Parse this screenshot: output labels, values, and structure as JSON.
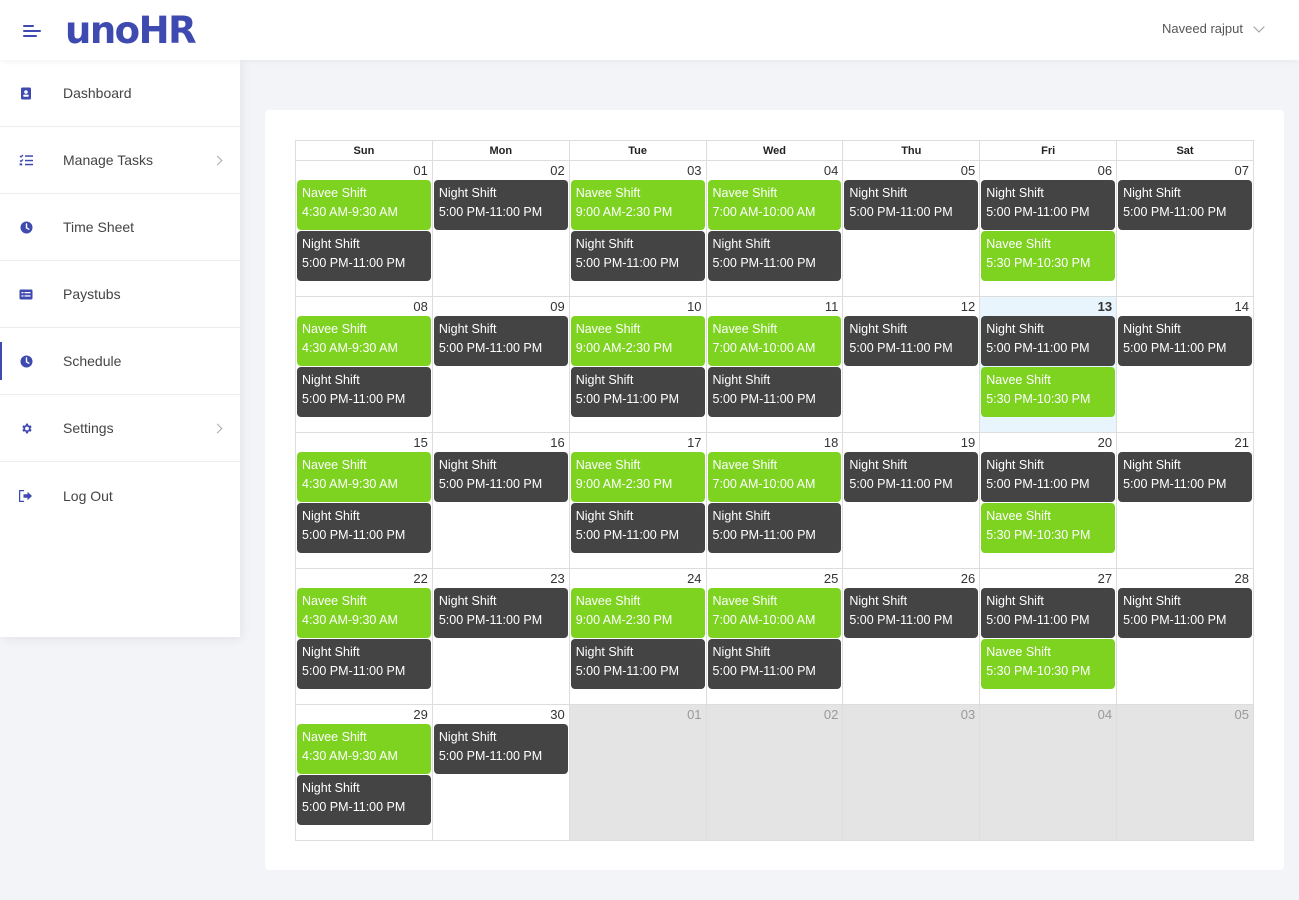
{
  "app": {
    "logo": "unoHR"
  },
  "header": {
    "user_name": "Naveed rajput"
  },
  "sidebar": {
    "items": [
      {
        "label": "Dashboard",
        "icon": "dashboard-icon",
        "has_arrow": false,
        "active": false
      },
      {
        "label": "Manage Tasks",
        "icon": "tasks-icon",
        "has_arrow": true,
        "active": false
      },
      {
        "label": "Time Sheet",
        "icon": "clock-icon",
        "has_arrow": false,
        "active": false
      },
      {
        "label": "Paystubs",
        "icon": "paystub-icon",
        "has_arrow": false,
        "active": false
      },
      {
        "label": "Schedule",
        "icon": "clock-icon",
        "has_arrow": false,
        "active": true
      },
      {
        "label": "Settings",
        "icon": "gear-icon",
        "has_arrow": true,
        "active": false
      },
      {
        "label": "Log Out",
        "icon": "logout-icon",
        "has_arrow": false,
        "active": false
      }
    ]
  },
  "colors": {
    "accent": "#3e4ab0",
    "shift_green": "#7ed321",
    "shift_dark": "#444444",
    "today_bg": "#e9f5fd",
    "other_month_bg": "#e4e4e4"
  },
  "calendar": {
    "weekdays": [
      "Sun",
      "Mon",
      "Tue",
      "Wed",
      "Thu",
      "Fri",
      "Sat"
    ],
    "shifts": {
      "navee_sun": {
        "name": "Navee Shift",
        "time": "4:30 AM-9:30 AM",
        "color": "green"
      },
      "navee_tue": {
        "name": "Navee Shift",
        "time": "9:00 AM-2:30 PM",
        "color": "green"
      },
      "navee_wed": {
        "name": "Navee Shift",
        "time": "7:00 AM-10:00 AM",
        "color": "green"
      },
      "navee_fri": {
        "name": "Navee Shift",
        "time": "5:30 PM-10:30 PM",
        "color": "green"
      },
      "night": {
        "name": "Night Shift",
        "time": "5:00 PM-11:00 PM",
        "color": "dark"
      }
    },
    "weeks": [
      [
        {
          "day": "01",
          "events": [
            "navee_sun",
            "night"
          ]
        },
        {
          "day": "02",
          "events": [
            "night"
          ]
        },
        {
          "day": "03",
          "events": [
            "navee_tue",
            "night"
          ]
        },
        {
          "day": "04",
          "events": [
            "navee_wed",
            "night"
          ]
        },
        {
          "day": "05",
          "events": [
            "night"
          ]
        },
        {
          "day": "06",
          "events": [
            "night",
            "navee_fri"
          ]
        },
        {
          "day": "07",
          "events": [
            "night"
          ]
        }
      ],
      [
        {
          "day": "08",
          "events": [
            "navee_sun",
            "night"
          ]
        },
        {
          "day": "09",
          "events": [
            "night"
          ]
        },
        {
          "day": "10",
          "events": [
            "navee_tue",
            "night"
          ]
        },
        {
          "day": "11",
          "events": [
            "navee_wed",
            "night"
          ]
        },
        {
          "day": "12",
          "events": [
            "night"
          ]
        },
        {
          "day": "13",
          "today": true,
          "events": [
            "night",
            "navee_fri"
          ]
        },
        {
          "day": "14",
          "events": [
            "night"
          ]
        }
      ],
      [
        {
          "day": "15",
          "events": [
            "navee_sun",
            "night"
          ]
        },
        {
          "day": "16",
          "events": [
            "night"
          ]
        },
        {
          "day": "17",
          "events": [
            "navee_tue",
            "night"
          ]
        },
        {
          "day": "18",
          "events": [
            "navee_wed",
            "night"
          ]
        },
        {
          "day": "19",
          "events": [
            "night"
          ]
        },
        {
          "day": "20",
          "events": [
            "night",
            "navee_fri"
          ]
        },
        {
          "day": "21",
          "events": [
            "night"
          ]
        }
      ],
      [
        {
          "day": "22",
          "events": [
            "navee_sun",
            "night"
          ]
        },
        {
          "day": "23",
          "events": [
            "night"
          ]
        },
        {
          "day": "24",
          "events": [
            "navee_tue",
            "night"
          ]
        },
        {
          "day": "25",
          "events": [
            "navee_wed",
            "night"
          ]
        },
        {
          "day": "26",
          "events": [
            "night"
          ]
        },
        {
          "day": "27",
          "events": [
            "night",
            "navee_fri"
          ]
        },
        {
          "day": "28",
          "events": [
            "night"
          ]
        }
      ],
      [
        {
          "day": "29",
          "events": [
            "navee_sun",
            "night"
          ]
        },
        {
          "day": "30",
          "events": [
            "night"
          ]
        },
        {
          "day": "01",
          "other_month": true,
          "events": []
        },
        {
          "day": "02",
          "other_month": true,
          "events": []
        },
        {
          "day": "03",
          "other_month": true,
          "events": []
        },
        {
          "day": "04",
          "other_month": true,
          "events": []
        },
        {
          "day": "05",
          "other_month": true,
          "events": []
        }
      ]
    ]
  }
}
